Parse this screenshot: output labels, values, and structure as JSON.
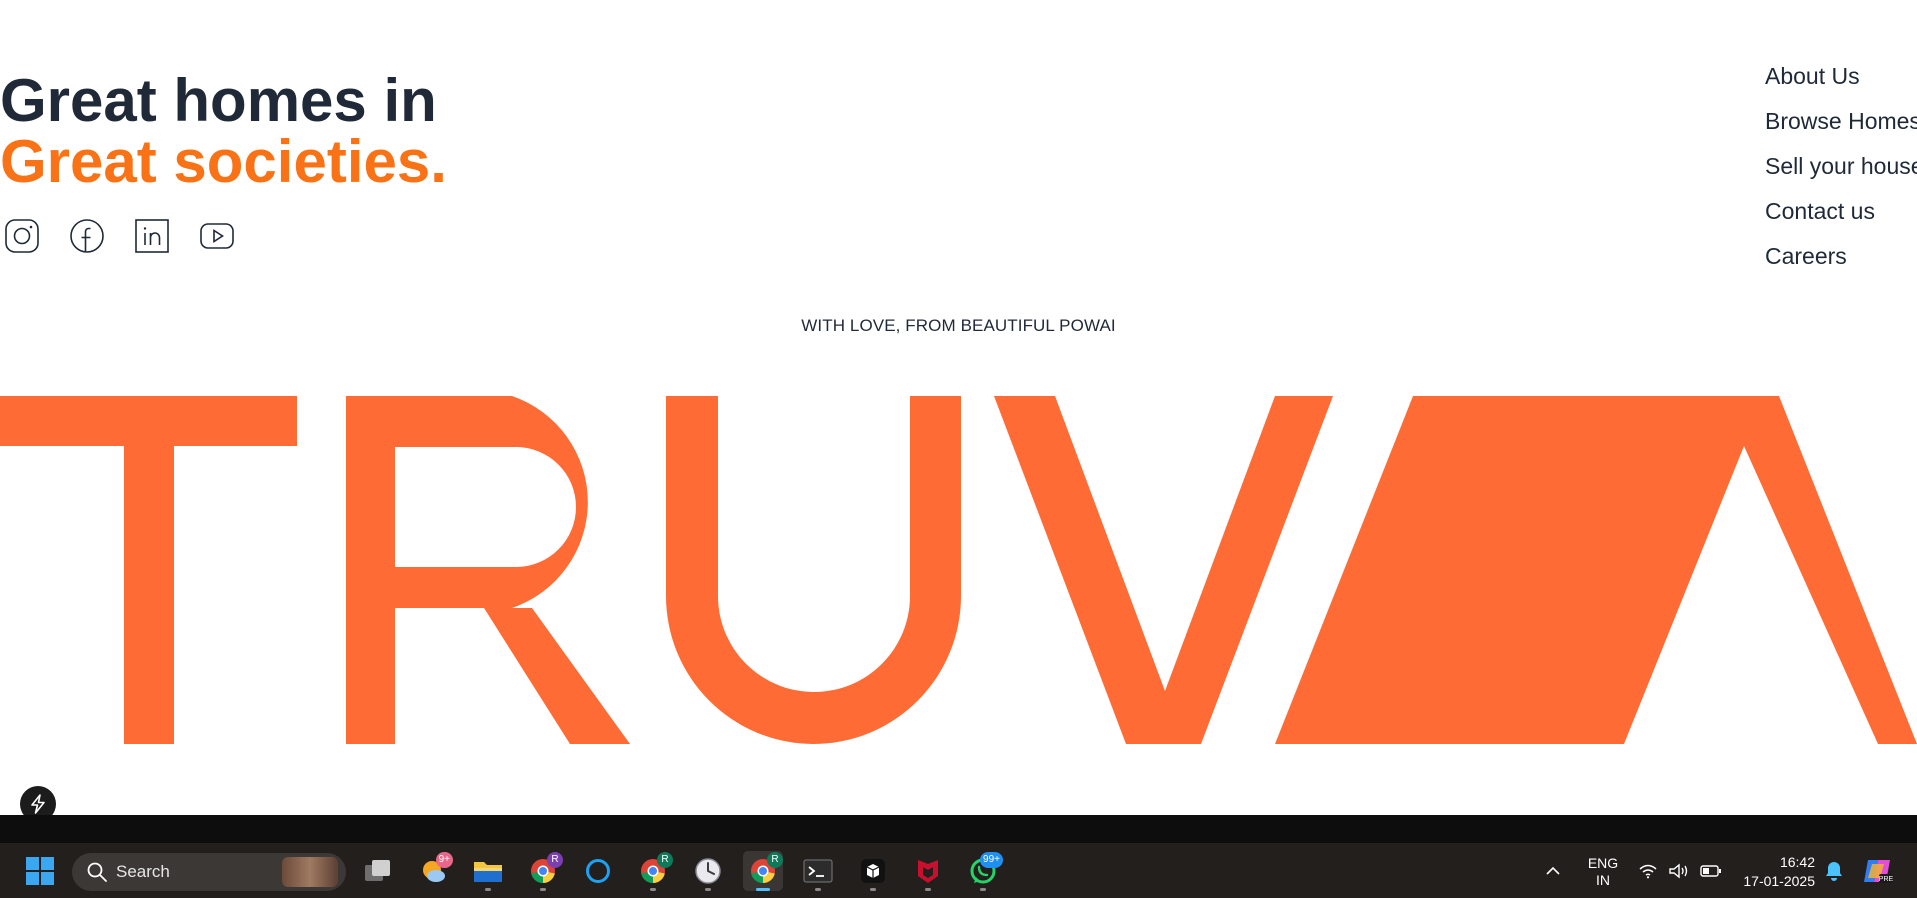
{
  "hero": {
    "line1": "Great homes in",
    "line2": "Great societies."
  },
  "social": [
    "instagram-icon",
    "facebook-icon",
    "linkedin-icon",
    "youtube-icon"
  ],
  "nav": {
    "items": [
      "About Us",
      "Browse Homes",
      "Sell your house",
      "Contact us",
      "Careers"
    ]
  },
  "tagline": "WITH LOVE, FROM BEAUTIFUL POWAI",
  "brand": {
    "wordmark": "TRUVA",
    "color": "#ff6b35"
  },
  "colors": {
    "heading_dark": "#1f2937",
    "accent_orange": "#f97316",
    "taskbar_bg": "#221f1d"
  },
  "taskbar": {
    "search_label": "Search",
    "apps": [
      {
        "name": "task-view",
        "badge": ""
      },
      {
        "name": "weather",
        "badge": "9+"
      },
      {
        "name": "file-explorer",
        "badge": ""
      },
      {
        "name": "chrome",
        "badge": "R"
      },
      {
        "name": "cortana",
        "badge": ""
      },
      {
        "name": "chrome",
        "badge": "R"
      },
      {
        "name": "clock-app",
        "badge": ""
      },
      {
        "name": "chrome",
        "badge": "R",
        "active": true
      },
      {
        "name": "terminal",
        "badge": ""
      },
      {
        "name": "app-box",
        "badge": ""
      },
      {
        "name": "mcafee",
        "badge": ""
      },
      {
        "name": "whatsapp",
        "badge": "99+"
      }
    ],
    "tray": {
      "lang_line1": "ENG",
      "lang_line2": "IN",
      "time": "16:42",
      "date": "17-01-2025"
    }
  }
}
